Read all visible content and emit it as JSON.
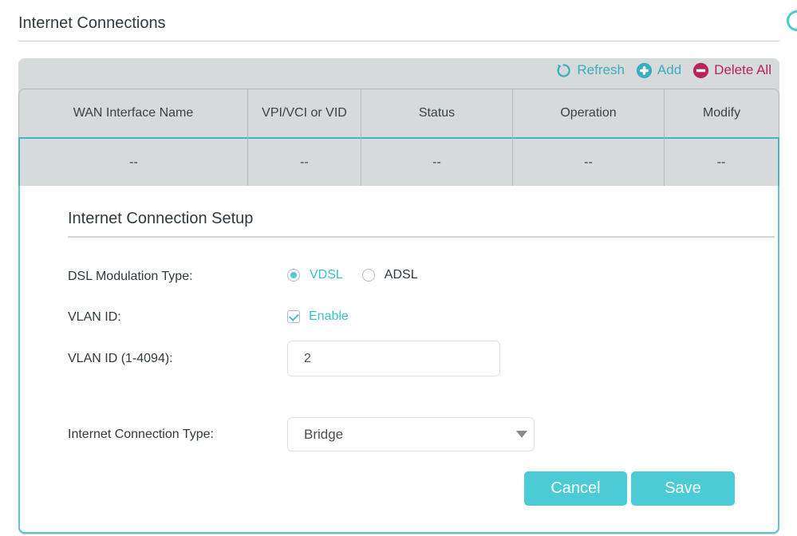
{
  "header": {
    "title": "Internet Connections",
    "help_icon": "help-icon"
  },
  "toolbar": {
    "refresh_label": "Refresh",
    "refresh_icon": "refresh-icon",
    "add_label": "Add",
    "add_icon": "plus-circle-icon",
    "delete_all_label": "Delete All",
    "delete_all_icon": "minus-circle-icon"
  },
  "table": {
    "columns": [
      "WAN Interface Name",
      "VPI/VCI or VID",
      "Status",
      "Operation",
      "Modify"
    ],
    "rows": [
      [
        "--",
        "--",
        "--",
        "--",
        "--"
      ]
    ]
  },
  "setup": {
    "title": "Internet Connection Setup",
    "dsl_modulation": {
      "label": "DSL Modulation Type:",
      "options": [
        "VDSL",
        "ADSL"
      ],
      "selected": "VDSL"
    },
    "vlan": {
      "label": "VLAN ID:",
      "checkbox_label": "Enable",
      "checked": true
    },
    "vlan_id": {
      "label": "VLAN ID (1-4094):",
      "value": "2"
    },
    "connection_type": {
      "label": "Internet Connection Type:",
      "selected": "Bridge"
    },
    "cancel_label": "Cancel",
    "save_label": "Save"
  },
  "colors": {
    "accent": "#4acbd6",
    "delete": "#b8235a",
    "panel_bg": "#d7dadb"
  }
}
